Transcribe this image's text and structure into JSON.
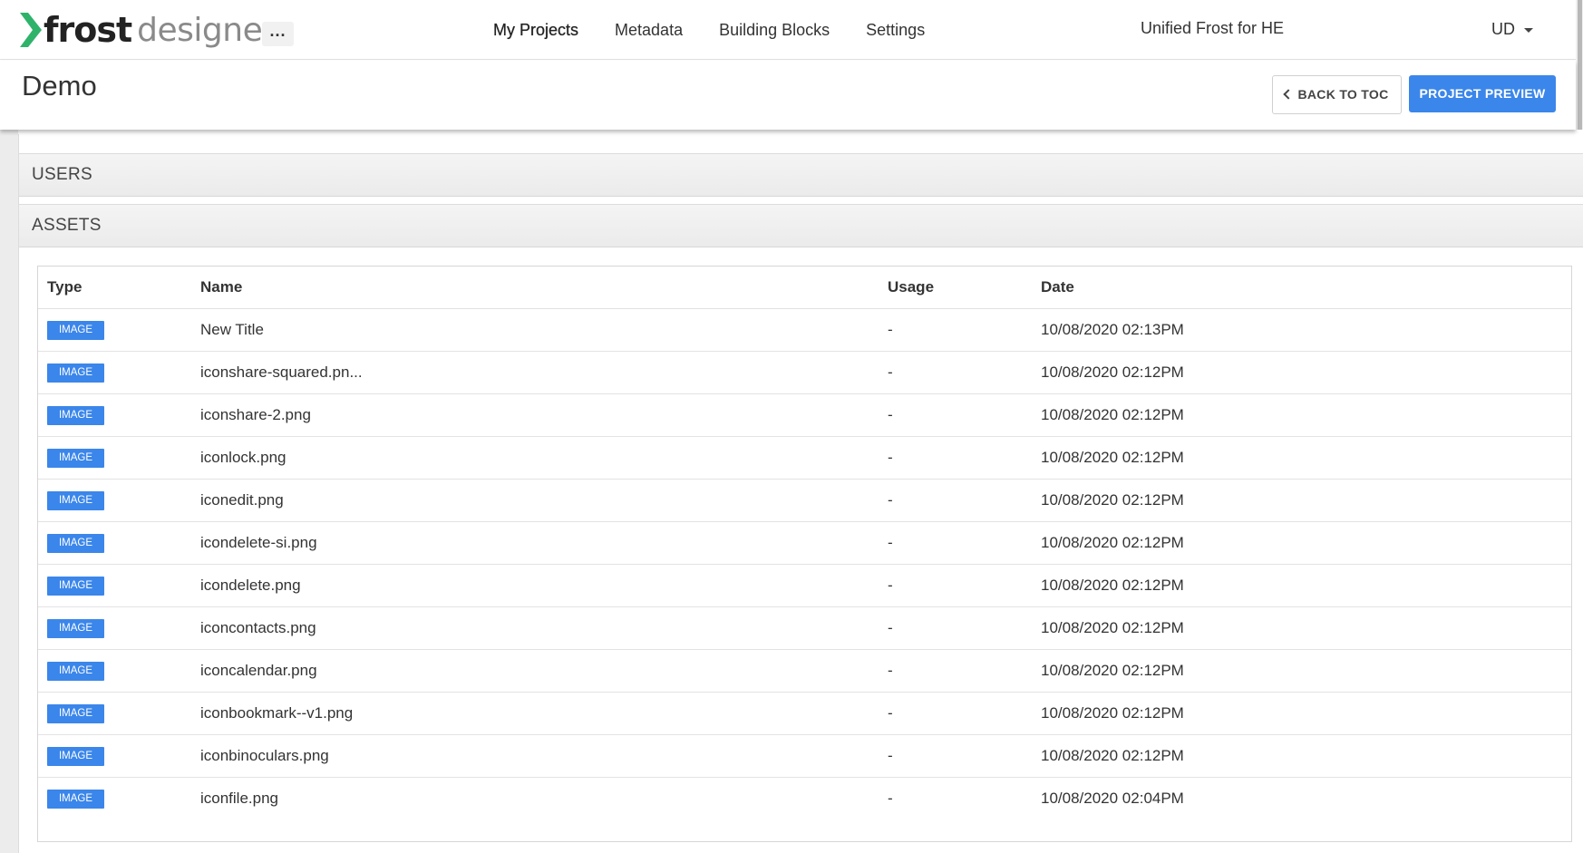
{
  "logo": {
    "bold": "frost",
    "light": "designer"
  },
  "nav": {
    "more": "...",
    "links": [
      "My Projects",
      "Metadata",
      "Building Blocks",
      "Settings"
    ],
    "org": "Unified Frost for HE",
    "user": "UD"
  },
  "page": {
    "title": "Demo",
    "back_label": "BACK TO TOC",
    "preview_label": "PROJECT PREVIEW"
  },
  "sections": {
    "users": "USERS",
    "assets": "ASSETS"
  },
  "assets_table": {
    "headers": {
      "type": "Type",
      "name": "Name",
      "usage": "Usage",
      "date": "Date"
    },
    "rows": [
      {
        "type": "IMAGE",
        "name": "New Title",
        "usage": "-",
        "date": "10/08/2020 02:13PM"
      },
      {
        "type": "IMAGE",
        "name": "iconshare-squared.pn...",
        "usage": "-",
        "date": "10/08/2020 02:12PM"
      },
      {
        "type": "IMAGE",
        "name": "iconshare-2.png",
        "usage": "-",
        "date": "10/08/2020 02:12PM"
      },
      {
        "type": "IMAGE",
        "name": "iconlock.png",
        "usage": "-",
        "date": "10/08/2020 02:12PM"
      },
      {
        "type": "IMAGE",
        "name": "iconedit.png",
        "usage": "-",
        "date": "10/08/2020 02:12PM"
      },
      {
        "type": "IMAGE",
        "name": "icondelete-si.png",
        "usage": "-",
        "date": "10/08/2020 02:12PM"
      },
      {
        "type": "IMAGE",
        "name": "icondelete.png",
        "usage": "-",
        "date": "10/08/2020 02:12PM"
      },
      {
        "type": "IMAGE",
        "name": "iconcontacts.png",
        "usage": "-",
        "date": "10/08/2020 02:12PM"
      },
      {
        "type": "IMAGE",
        "name": "iconcalendar.png",
        "usage": "-",
        "date": "10/08/2020 02:12PM"
      },
      {
        "type": "IMAGE",
        "name": "iconbookmark--v1.png",
        "usage": "-",
        "date": "10/08/2020 02:12PM"
      },
      {
        "type": "IMAGE",
        "name": "iconbinoculars.png",
        "usage": "-",
        "date": "10/08/2020 02:12PM"
      },
      {
        "type": "IMAGE",
        "name": "iconfile.png",
        "usage": "-",
        "date": "10/08/2020 02:04PM"
      }
    ]
  },
  "colors": {
    "accent": "#3b86ea",
    "logo_green": "#2fb36b"
  }
}
